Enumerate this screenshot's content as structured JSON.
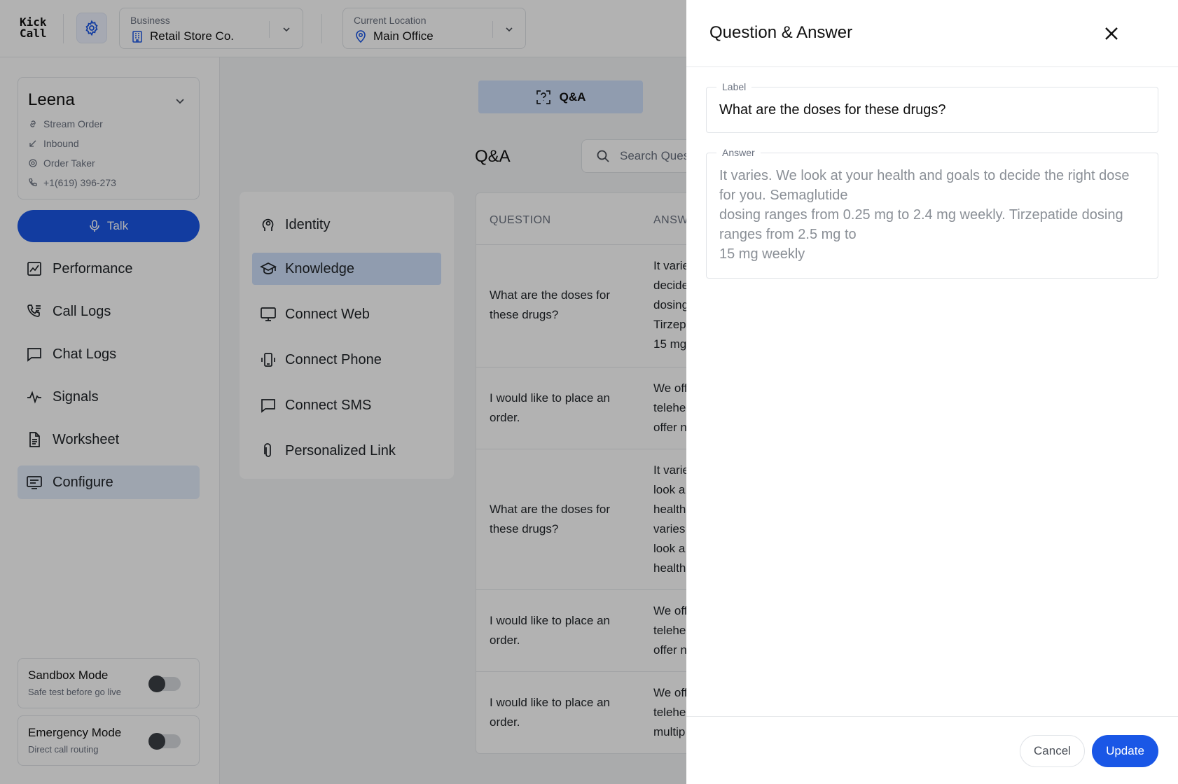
{
  "app": {
    "logo_line1": "Kick",
    "logo_line2": "Call"
  },
  "header": {
    "business": {
      "label": "Business",
      "value": "Retail Store Co.",
      "icon": "building-icon"
    },
    "location": {
      "label": "Current Location",
      "value": "Main Office",
      "icon": "map-pin-icon"
    }
  },
  "agent": {
    "name": "Leena",
    "meta": [
      {
        "icon": "link-icon",
        "text": "Stream Order"
      },
      {
        "icon": "arrow-down-left-icon",
        "text": "Inbound"
      },
      {
        "icon": "gear-icon",
        "text": "Order Taker"
      },
      {
        "icon": "phone-icon",
        "text": "+1(619) 396-273"
      }
    ],
    "talk_label": "Talk"
  },
  "nav": {
    "items": [
      {
        "label": "Performance",
        "icon": "chart-icon",
        "active": false
      },
      {
        "label": "Call Logs",
        "icon": "phone-list-icon",
        "active": false
      },
      {
        "label": "Chat Logs",
        "icon": "chat-icon",
        "active": false
      },
      {
        "label": "Signals",
        "icon": "pulse-icon",
        "active": false
      },
      {
        "label": "Worksheet",
        "icon": "document-icon",
        "active": false
      },
      {
        "label": "Configure",
        "icon": "configure-icon",
        "active": true
      }
    ]
  },
  "modes": [
    {
      "title": "Sandbox Mode",
      "subtitle": "Safe test before go live",
      "enabled": false
    },
    {
      "title": "Emergency Mode",
      "subtitle": "Direct call routing",
      "enabled": false
    }
  ],
  "main": {
    "tab_label": "Q&A",
    "heading": "Q&A",
    "search_placeholder": "Search Ques",
    "submenu": [
      {
        "label": "Identity",
        "icon": "head-icon",
        "active": false
      },
      {
        "label": "Knowledge",
        "icon": "graduation-cap-icon",
        "active": true
      },
      {
        "label": "Connect Web",
        "icon": "monitor-icon",
        "active": false
      },
      {
        "label": "Connect Phone",
        "icon": "phone-vibrate-icon",
        "active": false
      },
      {
        "label": "Connect SMS",
        "icon": "message-square-icon",
        "active": false
      },
      {
        "label": "Personalized Link",
        "icon": "paperclip-icon",
        "active": false
      }
    ],
    "table": {
      "columns": [
        "QUESTION",
        "ANSW"
      ],
      "rows": [
        {
          "question": "What are the doses for these drugs?",
          "answer": "It varie\ndecide\ndosing\nTirzep\n15 mg"
        },
        {
          "question": "I would like to place an order.",
          "answer": "We off\ntelehe\noffer n"
        },
        {
          "question": "What are the doses for these drugs?",
          "answer": "It varie\nlook a\nhealth\nvaries\nlook a\nhealth"
        },
        {
          "question": "I would like to place an order.",
          "answer": "We off\ntelehe\noffer n"
        },
        {
          "question": "I would like to place an order.",
          "answer": "We off\ntelehe\nmultip"
        }
      ]
    }
  },
  "panel": {
    "title": "Question & Answer",
    "label_legend": "Label",
    "label_value": "What are the doses for these drugs?",
    "answer_legend": "Answer",
    "answer_value": "It varies. We look at your health and goals to decide the right dose for you. Semaglutide\ndosing ranges from 0.25 mg to 2.4 mg weekly. Tirzepatide dosing ranges from 2.5 mg to\n15 mg weekly",
    "cancel_label": "Cancel",
    "update_label": "Update"
  },
  "colors": {
    "primary": "#1a57e6",
    "active_bg": "#cfe0fb",
    "overlay": "rgba(0,0,0,0.30)"
  }
}
